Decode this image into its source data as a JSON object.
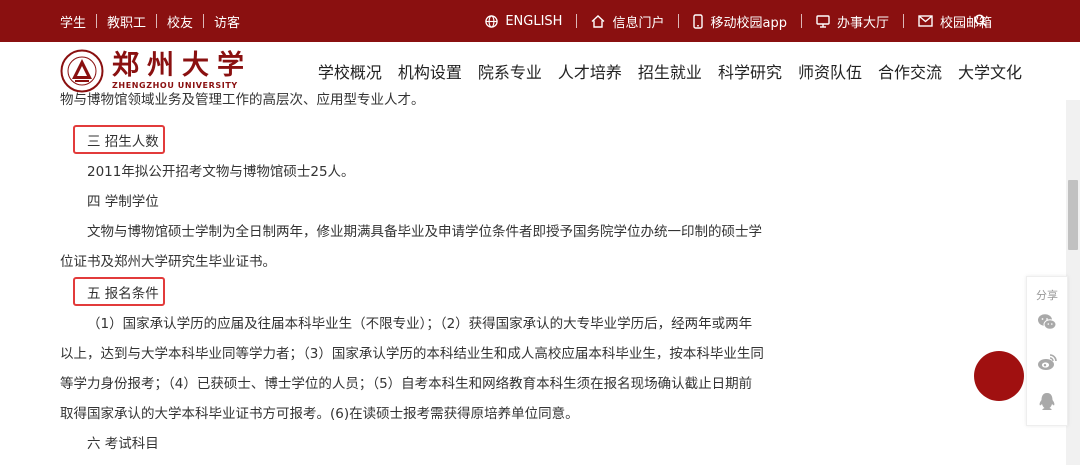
{
  "topbar": {
    "left_links": [
      "学生",
      "教职工",
      "校友",
      "访客"
    ],
    "right_links": [
      {
        "icon": "globe-icon",
        "label": "ENGLISH"
      },
      {
        "icon": "home-icon",
        "label": "信息门户"
      },
      {
        "icon": "mobile-icon",
        "label": "移动校园app"
      },
      {
        "icon": "monitor-icon",
        "label": "办事大厅"
      },
      {
        "icon": "mail-icon",
        "label": "校园邮箱"
      }
    ],
    "search_icon": "search-icon"
  },
  "logo": {
    "cn": "郑州大学",
    "en": "ZHENGZHOU UNIVERSITY"
  },
  "nav": [
    "学校概况",
    "机构设置",
    "院系专业",
    "人才培养",
    "招生就业",
    "科学研究",
    "师资队伍",
    "合作交流",
    "大学文化"
  ],
  "article": {
    "partial_top": "物与博物馆领域业务及管理工作的高层次、应用型专业人才。",
    "heading3": "三 招生人数",
    "p3": "2011年拟公开招考文物与博物馆硕士25人。",
    "heading4": "四 学制学位",
    "p4_line1": "文物与博物馆硕士学制为全日制两年，修业期满具备毕业及申请学位条件者即授予国务院学位办统一印制的硕士学",
    "p4_line2": "位证书及郑州大学研究生毕业证书。",
    "heading5": "五 报名条件",
    "p5_line1": "（1）国家承认学历的应届及往届本科毕业生（不限专业）；（2）获得国家承认的大专毕业学历后，经两年或两年",
    "p5_line2": "以上，达到与大学本科毕业同等学力者；（3）国家承认学历的本科结业生和成人高校应届本科毕业生，按本科毕业生同",
    "p5_line3": "等学力身份报考；（4）已获硕士、博士学位的人员；（5）自考本科生和网络教育本科生须在报名现场确认截止日期前",
    "p5_line4": "取得国家承认的大学本科毕业证书方可报考。(6)在读硕士报考需获得原培养单位同意。",
    "heading6": "六 考试科目"
  },
  "share": {
    "title": "分享",
    "icons": [
      "wechat-icon",
      "weibo-icon",
      "qq-icon"
    ]
  },
  "colors": {
    "brand": "#8a1010",
    "highlight_box": "#e23b3b",
    "float_button": "#a01010"
  }
}
